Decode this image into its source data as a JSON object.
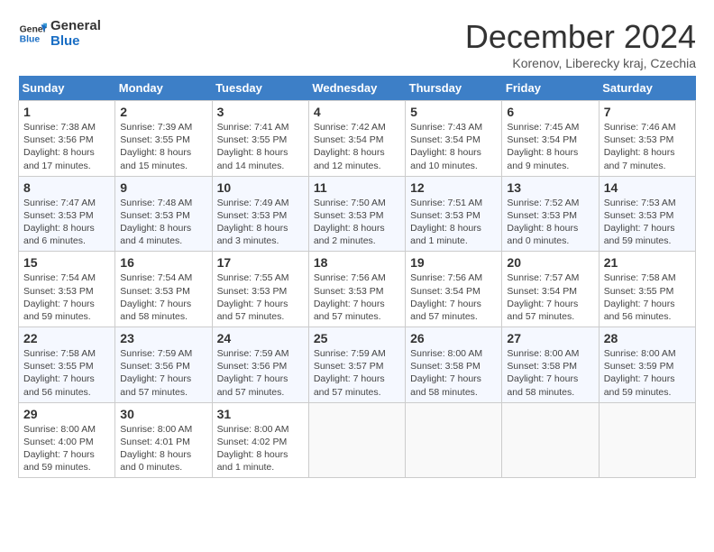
{
  "logo": {
    "line1": "General",
    "line2": "Blue"
  },
  "title": "December 2024",
  "subtitle": "Korenov, Liberecky kraj, Czechia",
  "days_header": [
    "Sunday",
    "Monday",
    "Tuesday",
    "Wednesday",
    "Thursday",
    "Friday",
    "Saturday"
  ],
  "weeks": [
    [
      {
        "day": "1",
        "sunrise": "Sunrise: 7:38 AM",
        "sunset": "Sunset: 3:56 PM",
        "daylight": "Daylight: 8 hours and 17 minutes."
      },
      {
        "day": "2",
        "sunrise": "Sunrise: 7:39 AM",
        "sunset": "Sunset: 3:55 PM",
        "daylight": "Daylight: 8 hours and 15 minutes."
      },
      {
        "day": "3",
        "sunrise": "Sunrise: 7:41 AM",
        "sunset": "Sunset: 3:55 PM",
        "daylight": "Daylight: 8 hours and 14 minutes."
      },
      {
        "day": "4",
        "sunrise": "Sunrise: 7:42 AM",
        "sunset": "Sunset: 3:54 PM",
        "daylight": "Daylight: 8 hours and 12 minutes."
      },
      {
        "day": "5",
        "sunrise": "Sunrise: 7:43 AM",
        "sunset": "Sunset: 3:54 PM",
        "daylight": "Daylight: 8 hours and 10 minutes."
      },
      {
        "day": "6",
        "sunrise": "Sunrise: 7:45 AM",
        "sunset": "Sunset: 3:54 PM",
        "daylight": "Daylight: 8 hours and 9 minutes."
      },
      {
        "day": "7",
        "sunrise": "Sunrise: 7:46 AM",
        "sunset": "Sunset: 3:53 PM",
        "daylight": "Daylight: 8 hours and 7 minutes."
      }
    ],
    [
      {
        "day": "8",
        "sunrise": "Sunrise: 7:47 AM",
        "sunset": "Sunset: 3:53 PM",
        "daylight": "Daylight: 8 hours and 6 minutes."
      },
      {
        "day": "9",
        "sunrise": "Sunrise: 7:48 AM",
        "sunset": "Sunset: 3:53 PM",
        "daylight": "Daylight: 8 hours and 4 minutes."
      },
      {
        "day": "10",
        "sunrise": "Sunrise: 7:49 AM",
        "sunset": "Sunset: 3:53 PM",
        "daylight": "Daylight: 8 hours and 3 minutes."
      },
      {
        "day": "11",
        "sunrise": "Sunrise: 7:50 AM",
        "sunset": "Sunset: 3:53 PM",
        "daylight": "Daylight: 8 hours and 2 minutes."
      },
      {
        "day": "12",
        "sunrise": "Sunrise: 7:51 AM",
        "sunset": "Sunset: 3:53 PM",
        "daylight": "Daylight: 8 hours and 1 minute."
      },
      {
        "day": "13",
        "sunrise": "Sunrise: 7:52 AM",
        "sunset": "Sunset: 3:53 PM",
        "daylight": "Daylight: 8 hours and 0 minutes."
      },
      {
        "day": "14",
        "sunrise": "Sunrise: 7:53 AM",
        "sunset": "Sunset: 3:53 PM",
        "daylight": "Daylight: 7 hours and 59 minutes."
      }
    ],
    [
      {
        "day": "15",
        "sunrise": "Sunrise: 7:54 AM",
        "sunset": "Sunset: 3:53 PM",
        "daylight": "Daylight: 7 hours and 59 minutes."
      },
      {
        "day": "16",
        "sunrise": "Sunrise: 7:54 AM",
        "sunset": "Sunset: 3:53 PM",
        "daylight": "Daylight: 7 hours and 58 minutes."
      },
      {
        "day": "17",
        "sunrise": "Sunrise: 7:55 AM",
        "sunset": "Sunset: 3:53 PM",
        "daylight": "Daylight: 7 hours and 57 minutes."
      },
      {
        "day": "18",
        "sunrise": "Sunrise: 7:56 AM",
        "sunset": "Sunset: 3:53 PM",
        "daylight": "Daylight: 7 hours and 57 minutes."
      },
      {
        "day": "19",
        "sunrise": "Sunrise: 7:56 AM",
        "sunset": "Sunset: 3:54 PM",
        "daylight": "Daylight: 7 hours and 57 minutes."
      },
      {
        "day": "20",
        "sunrise": "Sunrise: 7:57 AM",
        "sunset": "Sunset: 3:54 PM",
        "daylight": "Daylight: 7 hours and 57 minutes."
      },
      {
        "day": "21",
        "sunrise": "Sunrise: 7:58 AM",
        "sunset": "Sunset: 3:55 PM",
        "daylight": "Daylight: 7 hours and 56 minutes."
      }
    ],
    [
      {
        "day": "22",
        "sunrise": "Sunrise: 7:58 AM",
        "sunset": "Sunset: 3:55 PM",
        "daylight": "Daylight: 7 hours and 56 minutes."
      },
      {
        "day": "23",
        "sunrise": "Sunrise: 7:59 AM",
        "sunset": "Sunset: 3:56 PM",
        "daylight": "Daylight: 7 hours and 57 minutes."
      },
      {
        "day": "24",
        "sunrise": "Sunrise: 7:59 AM",
        "sunset": "Sunset: 3:56 PM",
        "daylight": "Daylight: 7 hours and 57 minutes."
      },
      {
        "day": "25",
        "sunrise": "Sunrise: 7:59 AM",
        "sunset": "Sunset: 3:57 PM",
        "daylight": "Daylight: 7 hours and 57 minutes."
      },
      {
        "day": "26",
        "sunrise": "Sunrise: 8:00 AM",
        "sunset": "Sunset: 3:58 PM",
        "daylight": "Daylight: 7 hours and 58 minutes."
      },
      {
        "day": "27",
        "sunrise": "Sunrise: 8:00 AM",
        "sunset": "Sunset: 3:58 PM",
        "daylight": "Daylight: 7 hours and 58 minutes."
      },
      {
        "day": "28",
        "sunrise": "Sunrise: 8:00 AM",
        "sunset": "Sunset: 3:59 PM",
        "daylight": "Daylight: 7 hours and 59 minutes."
      }
    ],
    [
      {
        "day": "29",
        "sunrise": "Sunrise: 8:00 AM",
        "sunset": "Sunset: 4:00 PM",
        "daylight": "Daylight: 7 hours and 59 minutes."
      },
      {
        "day": "30",
        "sunrise": "Sunrise: 8:00 AM",
        "sunset": "Sunset: 4:01 PM",
        "daylight": "Daylight: 8 hours and 0 minutes."
      },
      {
        "day": "31",
        "sunrise": "Sunrise: 8:00 AM",
        "sunset": "Sunset: 4:02 PM",
        "daylight": "Daylight: 8 hours and 1 minute."
      },
      null,
      null,
      null,
      null
    ]
  ]
}
